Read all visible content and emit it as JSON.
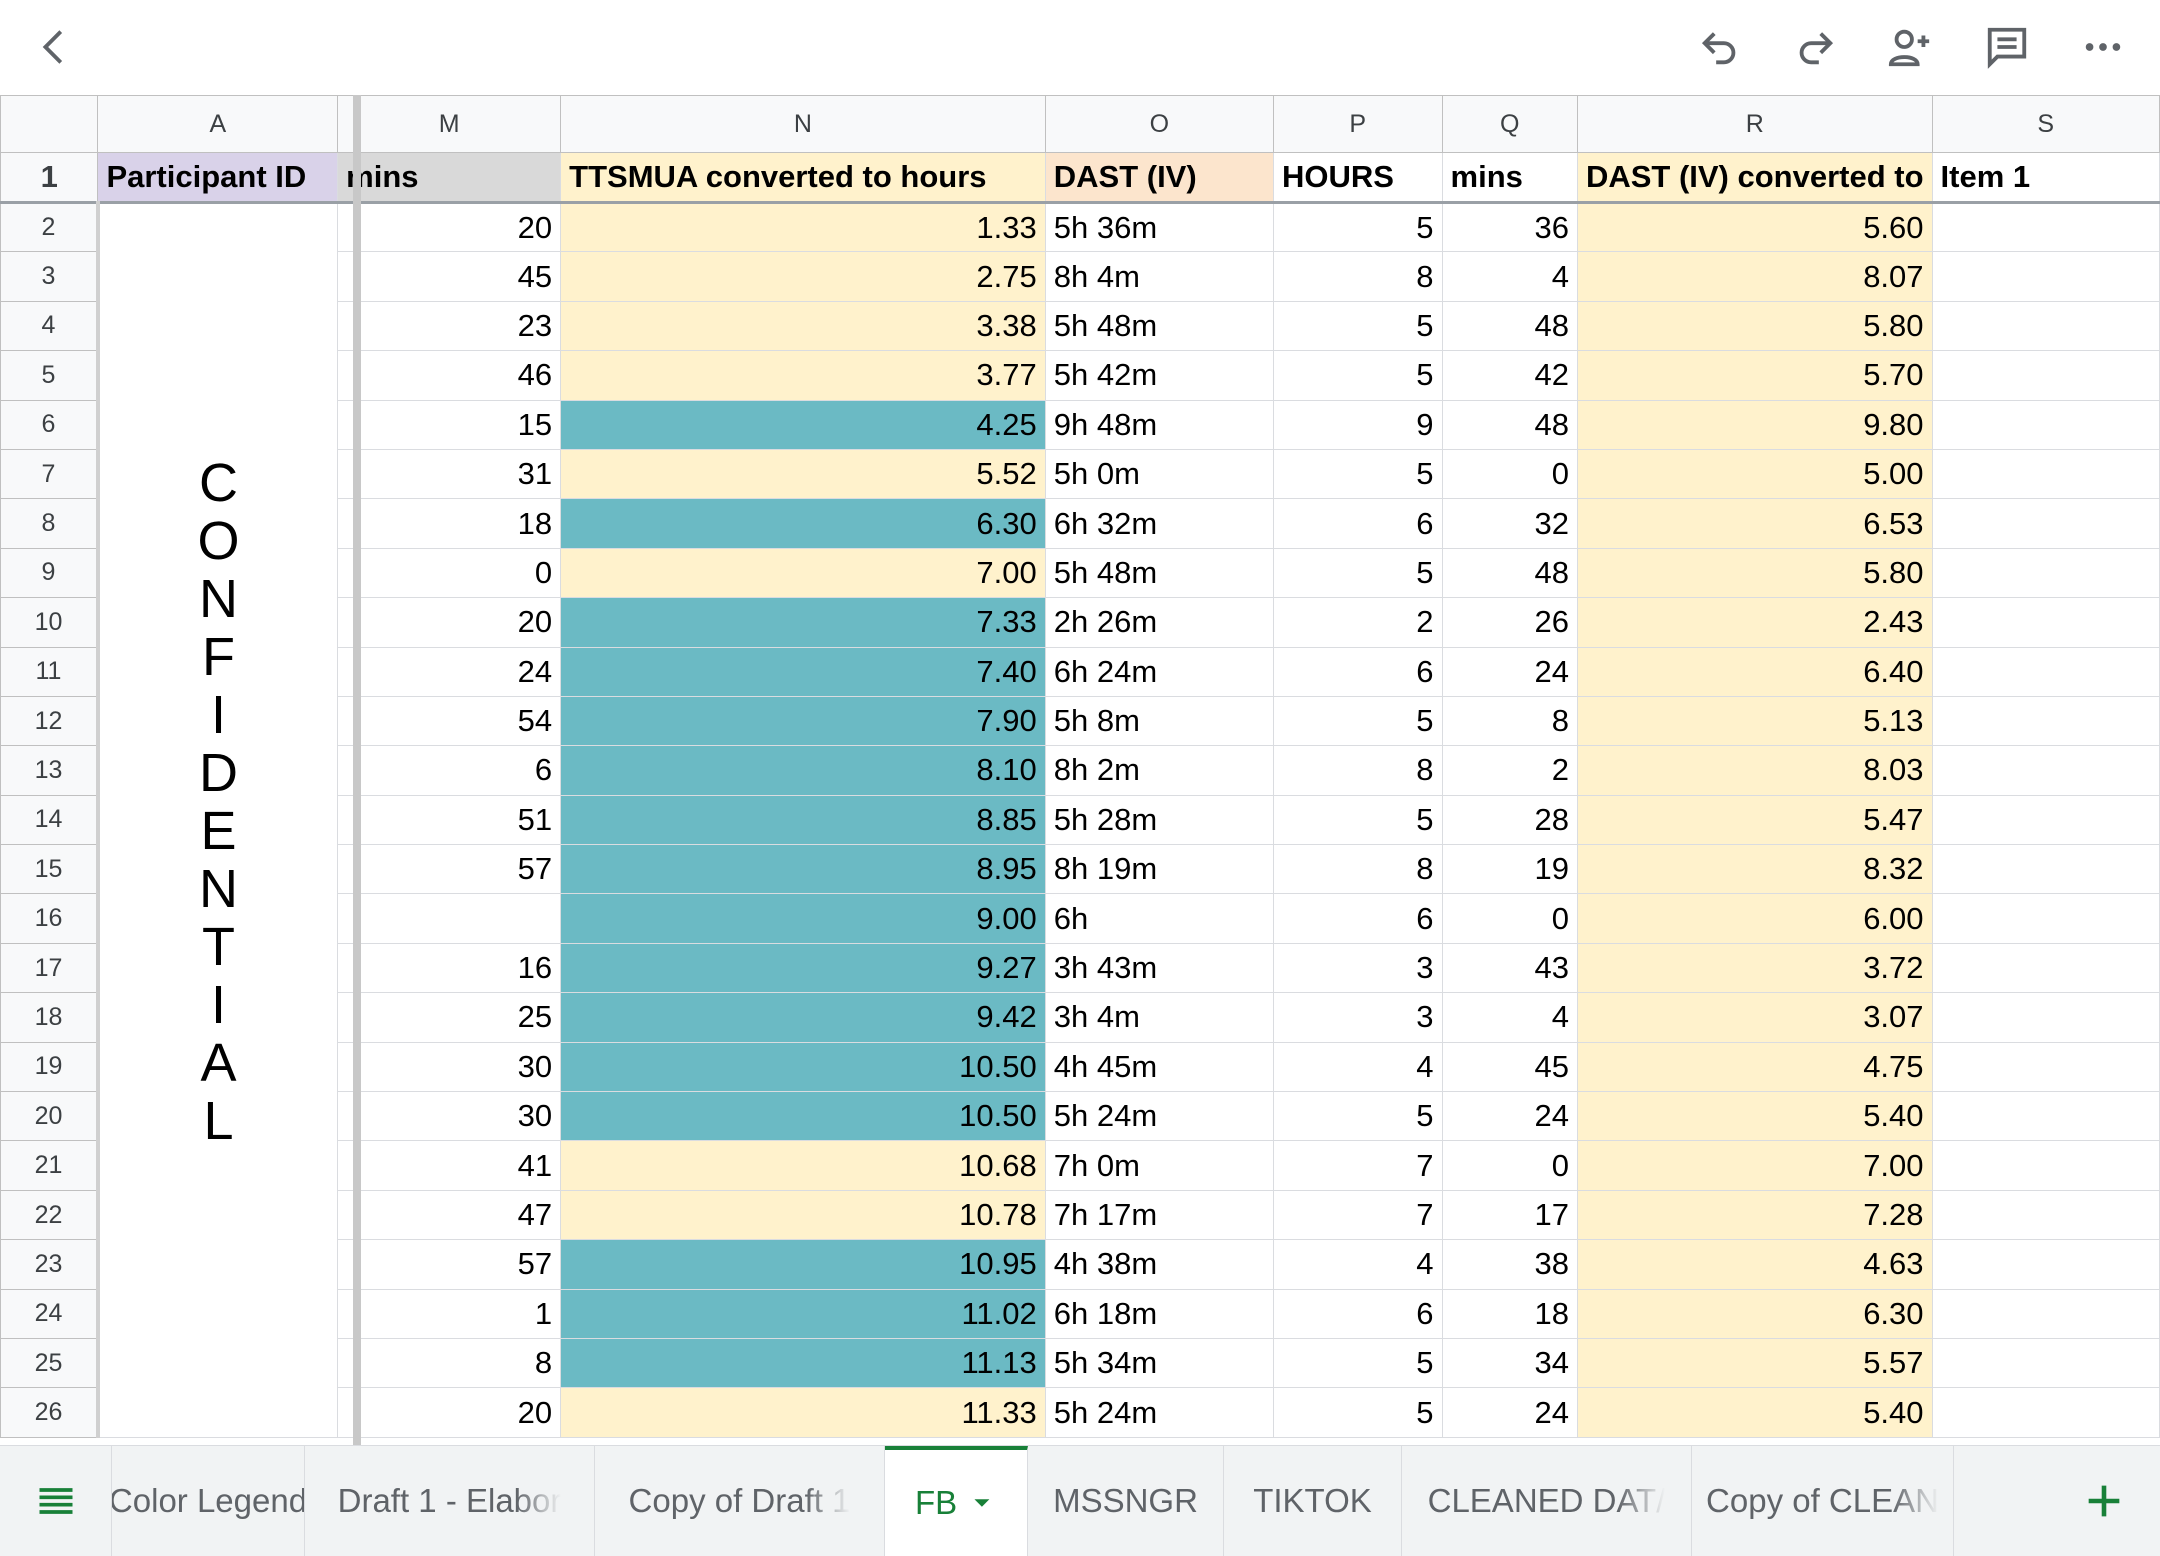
{
  "toolbar": {
    "back_icon": "chevron-left-icon",
    "undo_icon": "undo-icon",
    "redo_icon": "redo-icon",
    "share_icon": "add-person-icon",
    "comment_icon": "comment-icon",
    "more_icon": "more-horizontal-icon"
  },
  "columns": [
    "A",
    "M",
    "N",
    "O",
    "P",
    "Q",
    "R",
    "S"
  ],
  "header_row": {
    "num": "1",
    "A": "Participant ID",
    "M": "mins",
    "N": "TTSMUA converted to hours",
    "O": "DAST (IV)",
    "P": "HOURS",
    "Q": "mins",
    "R": "DAST (IV) converted to",
    "S": "Item 1"
  },
  "confidential": [
    "C",
    "O",
    "N",
    "F",
    "I",
    "D",
    "E",
    "N",
    "T",
    "I",
    "A",
    "L"
  ],
  "rows": [
    {
      "num": "2",
      "M": "20",
      "N": "1.33",
      "nt": false,
      "O": "5h 36m",
      "P": "5",
      "Q": "36",
      "R": "5.60"
    },
    {
      "num": "3",
      "M": "45",
      "N": "2.75",
      "nt": false,
      "O": "8h 4m",
      "P": "8",
      "Q": "4",
      "R": "8.07"
    },
    {
      "num": "4",
      "M": "23",
      "N": "3.38",
      "nt": false,
      "O": "5h 48m",
      "P": "5",
      "Q": "48",
      "R": "5.80"
    },
    {
      "num": "5",
      "M": "46",
      "N": "3.77",
      "nt": false,
      "O": "5h 42m",
      "P": "5",
      "Q": "42",
      "R": "5.70"
    },
    {
      "num": "6",
      "M": "15",
      "N": "4.25",
      "nt": true,
      "O": "9h 48m",
      "P": "9",
      "Q": "48",
      "R": "9.80"
    },
    {
      "num": "7",
      "M": "31",
      "N": "5.52",
      "nt": false,
      "O": "5h 0m",
      "P": "5",
      "Q": "0",
      "R": "5.00"
    },
    {
      "num": "8",
      "M": "18",
      "N": "6.30",
      "nt": true,
      "O": "6h 32m",
      "P": "6",
      "Q": "32",
      "R": "6.53"
    },
    {
      "num": "9",
      "M": "0",
      "N": "7.00",
      "nt": false,
      "O": "5h 48m",
      "P": "5",
      "Q": "48",
      "R": "5.80"
    },
    {
      "num": "10",
      "M": "20",
      "N": "7.33",
      "nt": true,
      "O": "2h 26m",
      "P": "2",
      "Q": "26",
      "R": "2.43"
    },
    {
      "num": "11",
      "M": "24",
      "N": "7.40",
      "nt": true,
      "O": "6h 24m",
      "P": "6",
      "Q": "24",
      "R": "6.40"
    },
    {
      "num": "12",
      "M": "54",
      "N": "7.90",
      "nt": true,
      "O": "5h 8m",
      "P": "5",
      "Q": "8",
      "R": "5.13"
    },
    {
      "num": "13",
      "M": "6",
      "N": "8.10",
      "nt": true,
      "O": "8h 2m",
      "P": "8",
      "Q": "2",
      "R": "8.03"
    },
    {
      "num": "14",
      "M": "51",
      "N": "8.85",
      "nt": true,
      "O": "5h 28m",
      "P": "5",
      "Q": "28",
      "R": "5.47"
    },
    {
      "num": "15",
      "M": "57",
      "N": "8.95",
      "nt": true,
      "O": "8h 19m",
      "P": "8",
      "Q": "19",
      "R": "8.32"
    },
    {
      "num": "16",
      "M": "",
      "N": "9.00",
      "nt": true,
      "O": "6h",
      "P": "6",
      "Q": "0",
      "R": "6.00"
    },
    {
      "num": "17",
      "M": "16",
      "N": "9.27",
      "nt": true,
      "O": "3h 43m",
      "P": "3",
      "Q": "43",
      "R": "3.72"
    },
    {
      "num": "18",
      "M": "25",
      "N": "9.42",
      "nt": true,
      "O": "3h 4m",
      "P": "3",
      "Q": "4",
      "R": "3.07"
    },
    {
      "num": "19",
      "M": "30",
      "N": "10.50",
      "nt": true,
      "O": "4h 45m",
      "P": "4",
      "Q": "45",
      "R": "4.75"
    },
    {
      "num": "20",
      "M": "30",
      "N": "10.50",
      "nt": true,
      "O": "5h 24m",
      "P": "5",
      "Q": "24",
      "R": "5.40"
    },
    {
      "num": "21",
      "M": "41",
      "N": "10.68",
      "nt": false,
      "O": "7h 0m",
      "P": "7",
      "Q": "0",
      "R": "7.00"
    },
    {
      "num": "22",
      "M": "47",
      "N": "10.78",
      "nt": false,
      "O": "7h 17m",
      "P": "7",
      "Q": "17",
      "R": "7.28"
    },
    {
      "num": "23",
      "M": "57",
      "N": "10.95",
      "nt": true,
      "O": "4h 38m",
      "P": "4",
      "Q": "38",
      "R": "4.63"
    },
    {
      "num": "24",
      "M": "1",
      "N": "11.02",
      "nt": true,
      "O": "6h 18m",
      "P": "6",
      "Q": "18",
      "R": "6.30"
    },
    {
      "num": "25",
      "M": "8",
      "N": "11.13",
      "nt": true,
      "O": "5h 34m",
      "P": "5",
      "Q": "34",
      "R": "5.57"
    },
    {
      "num": "26",
      "M": "20",
      "N": "11.33",
      "nt": false,
      "O": "5h 24m",
      "P": "5",
      "Q": "24",
      "R": "5.40"
    }
  ],
  "tabs": {
    "menu_icon": "sheet-list-icon",
    "items": [
      "Color Legend",
      "Draft 1 - Elabor",
      "Copy of Draft 1",
      "FB",
      "MSSNGR",
      "TIKTOK",
      "CLEANED DAT/",
      "Copy of CLEAN"
    ],
    "active": "FB",
    "dropdown_icon": "caret-down-icon",
    "add_icon": "plus-icon"
  },
  "colors": {
    "teal": "#6bbac4",
    "yellow": "#fff2cc",
    "lavender": "#d9d2e9",
    "gray": "#d9d9d9",
    "peach": "#fce5cd",
    "green": "#188038"
  }
}
